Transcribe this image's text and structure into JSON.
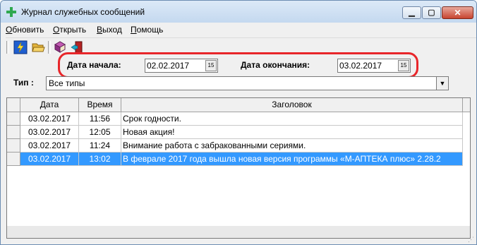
{
  "window": {
    "title": "Журнал служебных сообщений"
  },
  "menu": [
    "Обновить",
    "Открыть",
    "Выход",
    "Помощь"
  ],
  "toolbar": {
    "icons": [
      "lightning-icon",
      "folder-open-icon",
      "book-icon",
      "exit-door-icon"
    ]
  },
  "filters": {
    "start_label": "Дата начала:",
    "start_value": "02.02.2017",
    "end_label": "Дата окончания:",
    "end_value": "03.02.2017",
    "calendar_glyph": "15",
    "type_label": "Тип :",
    "type_value": "Все типы"
  },
  "table": {
    "columns": [
      "Дата",
      "Время",
      "Заголовок"
    ],
    "rows": [
      {
        "date": "03.02.2017",
        "time": "11:56",
        "title": "Срок годности."
      },
      {
        "date": "03.02.2017",
        "time": "12:05",
        "title": "Новая акция!"
      },
      {
        "date": "03.02.2017",
        "time": "11:24",
        "title": "Внимание работа с забракованными сериями."
      },
      {
        "date": "03.02.2017",
        "time": "13:02",
        "title": "В феврале 2017 года вышла новая версия программы «М-АПТЕКА плюс» 2.28.2"
      }
    ],
    "selected_row": 3
  },
  "colors": {
    "highlight": "#e8262a",
    "selection": "#3399ff"
  }
}
